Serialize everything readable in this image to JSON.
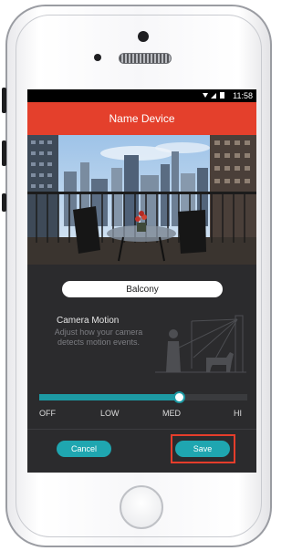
{
  "status_bar": {
    "time": "11:58",
    "icons": [
      "wifi-icon",
      "signal-icon",
      "battery-icon"
    ]
  },
  "header": {
    "title": "Name Device"
  },
  "device_name": {
    "value": "Balcony"
  },
  "camera_motion": {
    "title": "Camera Motion",
    "description": "Adjust how your camera detects motion events."
  },
  "slider": {
    "levels": [
      "OFF",
      "LOW",
      "MED",
      "HI"
    ],
    "selected": "MED",
    "value_fraction": 0.67
  },
  "actions": {
    "cancel_label": "Cancel",
    "save_label": "Save"
  },
  "colors": {
    "header": "#e4402c",
    "accent": "#1fa6b0",
    "highlight": "#e53d2b",
    "screen_bg": "#2b2b2d"
  }
}
